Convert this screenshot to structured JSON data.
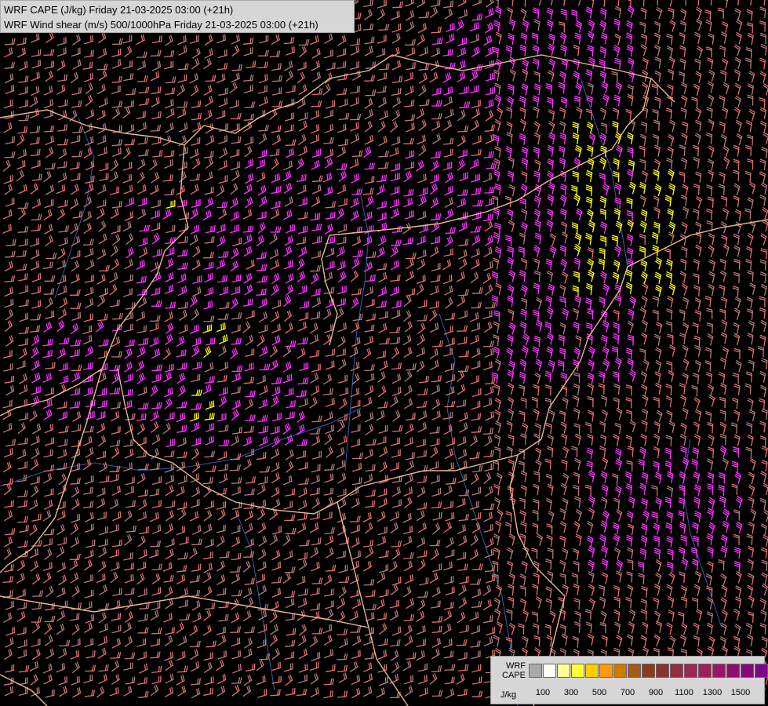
{
  "title": {
    "line1": "WRF CAPE (J/kg) Friday 21-03-2025 03:00 (+21h)",
    "line2": "WRF Wind shear (m/s) 500/1000hPa Friday 21-03-2025 03:00 (+21h)"
  },
  "legend": {
    "name_line1": "WRF",
    "name_line2": "CAPE",
    "unit": "J/kg",
    "colors": [
      "#a8a8a8",
      "#ffffff",
      "#ffff99",
      "#ffff33",
      "#ffcc00",
      "#ff9900",
      "#cc7a00",
      "#a35a1a",
      "#8a3a1a",
      "#8c3030",
      "#922d44",
      "#9a2850",
      "#a01e5a",
      "#9b1566",
      "#8e0d6e",
      "#850a78",
      "#7a0a82"
    ],
    "tick_labels": [
      "100",
      "300",
      "500",
      "700",
      "900",
      "1100",
      "1300",
      "1500"
    ]
  },
  "map": {
    "background": "#000000",
    "border_color": "#e8b890",
    "river_color": "#3a5aa8",
    "barb_colors": {
      "low": "#b87a7a",
      "mid": "#e07070",
      "high": "#ff33ff",
      "cape": "#ffff00"
    }
  }
}
